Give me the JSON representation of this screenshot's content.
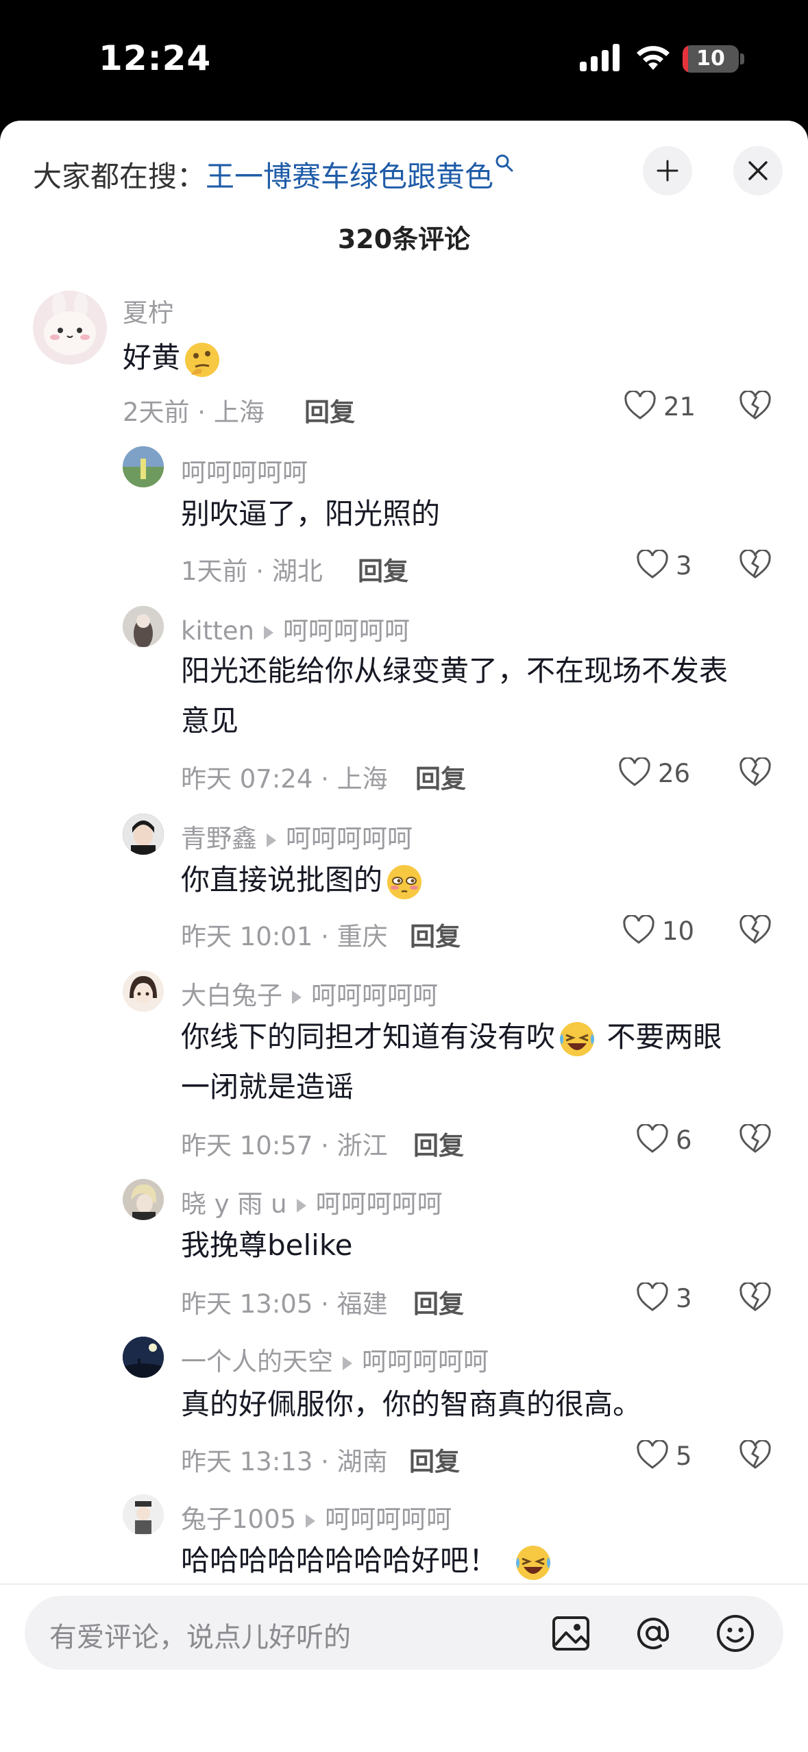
{
  "status_bar": {
    "time": "12:24",
    "battery": "10",
    "battery_level": 0.1
  },
  "header": {
    "search_prefix": "大家都在搜：",
    "search_keyword": "王一博赛车绿色跟黄色",
    "comment_count": "320条评论"
  },
  "comments": [
    {
      "user": "夏柠",
      "text": "好黄",
      "emoji": "thinking-emoji",
      "meta": "2天前 · 上海",
      "reply": "回复",
      "likes": "21"
    },
    {
      "user": "呵呵呵呵呵",
      "text": "别吹逼了，阳光照的",
      "meta": "1天前 · 湖北",
      "reply": "回复",
      "likes": "3"
    },
    {
      "user": "kitten",
      "reply_to": "呵呵呵呵呵",
      "text_lines": [
        "阳光还能给你从绿变黄了，不在现场不发表",
        "意见"
      ],
      "meta": "昨天 07:24 · 上海",
      "reply": "回复",
      "likes": "26"
    },
    {
      "user": "青野鑫",
      "reply_to": "呵呵呵呵呵",
      "text": "你直接说批图的",
      "emoji": "flushed-emoji",
      "meta": "昨天 10:01 · 重庆",
      "reply": "回复",
      "likes": "10"
    },
    {
      "user": "大白兔子",
      "reply_to": "呵呵呵呵呵",
      "text_line1_a": "你线下的同担才知道有没有吹",
      "emoji": "laughing-crying-emoji",
      "text_line1_b": " 不要两眼",
      "text_line2": "一闭就是造谣",
      "meta": "昨天 10:57 · 浙江",
      "reply": "回复",
      "likes": "6"
    },
    {
      "user": "晓 y 雨 u",
      "reply_to": "呵呵呵呵呵",
      "text": "我挽尊belike",
      "meta": "昨天 13:05 · 福建",
      "reply": "回复",
      "likes": "3"
    },
    {
      "user": "一个人的天空",
      "reply_to": "呵呵呵呵呵",
      "text": "真的好佩服你，你的智商真的很高。",
      "meta": "昨天 13:13 · 湖南",
      "reply": "回复",
      "likes": "5"
    },
    {
      "user": "兔子1005",
      "reply_to": "呵呵呵呵呵",
      "text": "哈哈哈哈哈哈哈哈好吧！",
      "emoji": "laughing-crying-emoji"
    }
  ],
  "bottom": {
    "placeholder": "有爱评论，说点儿好听的"
  }
}
